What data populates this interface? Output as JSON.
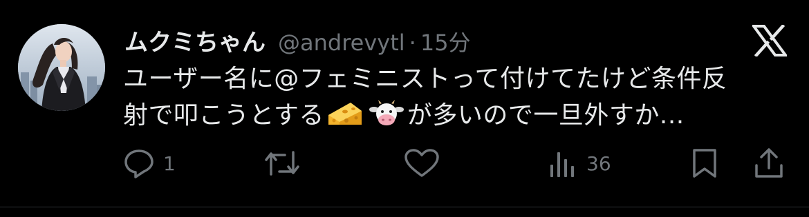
{
  "tweet": {
    "display_name": "ムクミちゃん",
    "handle": "@andrevytl",
    "separator": "·",
    "time": "15分",
    "text_line1": "ユーザー名に@フェミニストって付けてたけど条件反",
    "text_line2_before": "射で叩こうとする",
    "emoji_1": "cheese-emoji",
    "emoji_2": "cow-face-emoji",
    "text_line2_after": "が多いので一旦外すか..."
  },
  "actions": {
    "reply_count": "1",
    "retweet_count": "",
    "like_count": "",
    "views_count": "36"
  },
  "colors": {
    "background": "#000000",
    "primary_text": "#e7e9ea",
    "secondary_text": "#71767b",
    "icon": "#71767b",
    "divider": "#2f3336"
  },
  "icons": {
    "reply": "reply-icon",
    "retweet": "retweet-icon",
    "like": "heart-icon",
    "views": "views-bar-chart-icon",
    "bookmark": "bookmark-icon",
    "share": "share-icon",
    "brand": "x-logo-icon"
  }
}
